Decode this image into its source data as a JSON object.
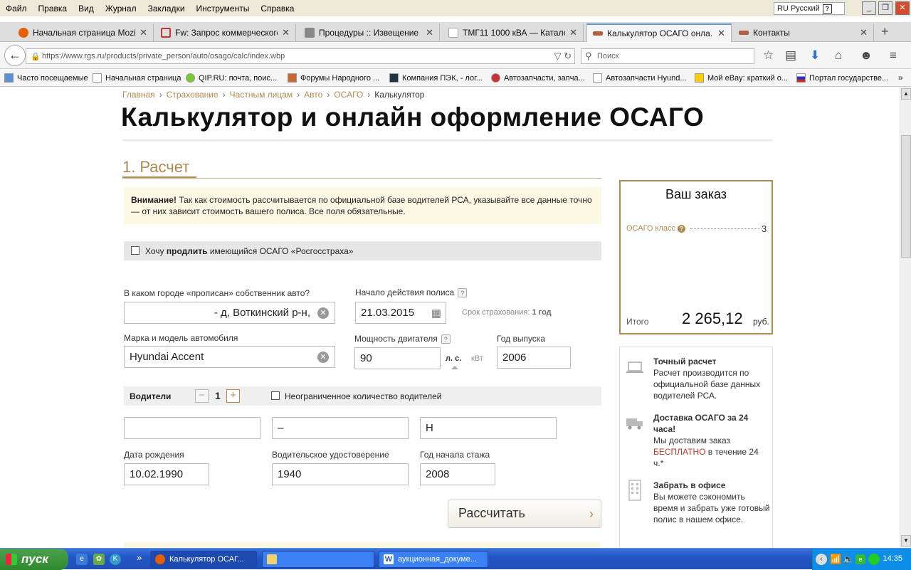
{
  "menu": [
    "Файл",
    "Правка",
    "Вид",
    "Журнал",
    "Закладки",
    "Инструменты",
    "Справка"
  ],
  "lang": "RU Русский",
  "tabs": [
    {
      "label": "Начальная страница Mozill...",
      "color": "#e66000"
    },
    {
      "label": "Fw: Запрос коммерческого...",
      "color": "#c33"
    },
    {
      "label": "Процедуры :: Извещение ...",
      "color": "#777"
    },
    {
      "label": "ТМГ11 1000 кВА — Катало...",
      "color": "#ddd"
    },
    {
      "label": "Калькулятор ОСАГО онла...",
      "color": "#b06040"
    },
    {
      "label": "Контакты",
      "color": "#b06040"
    }
  ],
  "url": "https://www.rgs.ru/products/private_person/auto/osago/calc/index.wbp",
  "search_placeholder": "Поиск",
  "bookmarks": [
    "Часто посещаемые",
    "Начальная страница",
    "QIP.RU: почта, поис...",
    "Форумы Народного ...",
    "Компания ПЭК, - лог...",
    "Автозапчасти, запча...",
    "Автозапчасти Hyund...",
    "Мой eBay: краткий о...",
    "Портал государстве..."
  ],
  "breadcrumbs": [
    "Главная",
    "Страхование",
    "Частным лицам",
    "Авто",
    "ОСАГО"
  ],
  "breadcrumb_current": "Калькулятор",
  "title": "Калькулятор и онлайн оформление ОСАГО",
  "step": {
    "num": "1.",
    "label": "Расчет"
  },
  "warning": {
    "bold": "Внимание!",
    "text": " Так как стоимость рассчитывается по официальной базе водителей РСА, указывайте все данные точно — от них зависит стоимость вашего полиса. Все поля обязательные."
  },
  "extend": {
    "pre": "Хочу ",
    "bold": "продлить",
    "post": " имеющийся ОСАГО «Росгосстраха»"
  },
  "form": {
    "city_label": "В каком городе «прописан» собственник авто?",
    "city_value": "-                         д, Воткинский р-н,",
    "start_label": "Начало действия полиса",
    "start_value": "21.03.2015",
    "term_label": "Срок страхования:",
    "term_value": "1 год",
    "car_label": "Марка и модель автомобиля",
    "car_value": "Hyundai Accent",
    "power_label": "Мощность двигателя",
    "power_value": "90",
    "unit_hp": "л. с.",
    "unit_kw": "кВт",
    "year_label": "Год выпуска",
    "year_value": "2006"
  },
  "drivers": {
    "label": "Водители",
    "count": "1",
    "unlimited": "Неограниченное количество водителей",
    "name2": "–",
    "name3": "Н",
    "birth_label": "Дата рождения",
    "birth_value": "10.02.1990",
    "license_label": "Водительское удостоверение",
    "license_value": "           1940",
    "exp_label": "Год начала стажа",
    "exp_value": "2008"
  },
  "calc_button": "Рассчитать",
  "order": {
    "title": "Ваш заказ",
    "class_label": "ОСАГО класс",
    "class_value": "3",
    "total_label": "Итого",
    "total_value": "2 265,12",
    "currency": "руб."
  },
  "features": [
    {
      "title": "Точный расчет",
      "text": "Расчет производится по официальной базе данных водителей РСА."
    },
    {
      "title": "Доставка ОСАГО за 24 часа!",
      "text_pre": "Мы доставим заказ ",
      "text_red": "БЕСПЛАТНО",
      "text_post": " в течение 24 ч.*"
    },
    {
      "title": "Забрать в офисе",
      "text": "Вы можете сэкономить время и забрать уже готовый полис в нашем офисе."
    }
  ],
  "taskbar": {
    "start": "пуск",
    "tasks": [
      "Калькулятор ОСАГ...",
      "",
      "аукционная_докуме..."
    ],
    "clock": "14:35"
  }
}
